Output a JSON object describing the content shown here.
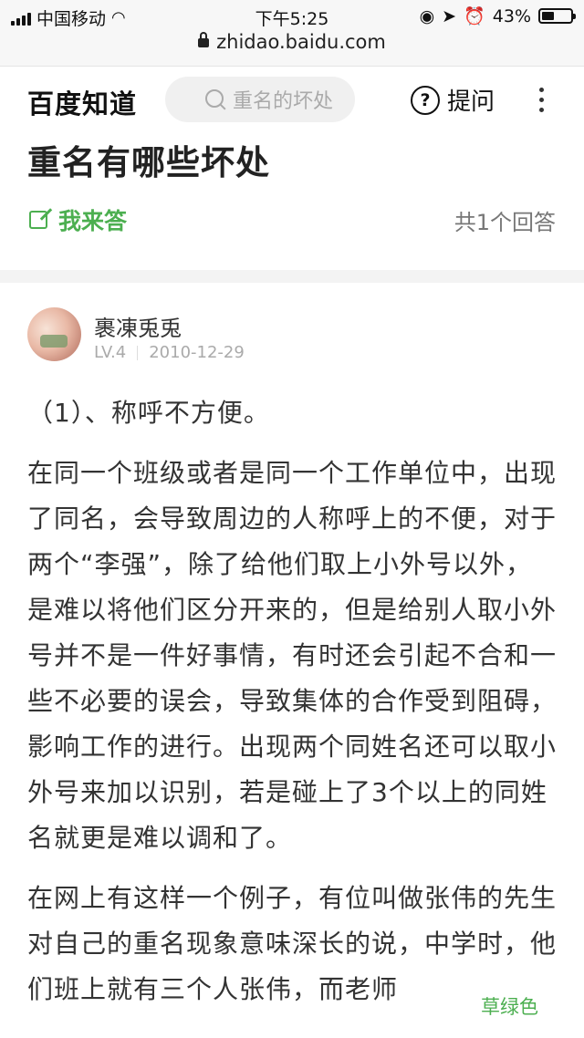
{
  "status_bar": {
    "carrier": "中国移动",
    "time": "下午5:25",
    "battery": "43%",
    "battery_level": 0.43,
    "url": "zhidao.baidu.com"
  },
  "navbar": {
    "logo": "百度知道",
    "search_placeholder": "重名的坏处",
    "ask_label": "提问"
  },
  "question": {
    "title": "重名有哪些坏处",
    "answer_button": "我来答",
    "answer_count": "共1个回答"
  },
  "answer": {
    "user": {
      "name": "裹凍兎兎",
      "level": "LV.4",
      "date": "2010-12-29"
    },
    "paragraphs": [
      "（1）、称呼不方便。",
      "在同一个班级或者是同一个工作单位中，出现了同名，会导致周边的人称呼上的不便，对于两个“李强”，除了给他们取上小外号以外，是难以将他们区分开来的，但是给别人取小外号并不是一件好事情，有时还会引起不合和一些不必要的误会，导致集体的合作受到阻碍，影响工作的进行。出现两个同姓名还可以取小外号来加以识别，若是碰上了3个以上的同姓名就更是难以调和了。",
      "在网上有这样一个例子，有位叫做张伟的先生对自己的重名现象意味深长的说，中学时，他们班上就有三个人张伟，而老师"
    ]
  },
  "watermark": "草绿色",
  "colors": {
    "accent_green": "#4caf50"
  }
}
